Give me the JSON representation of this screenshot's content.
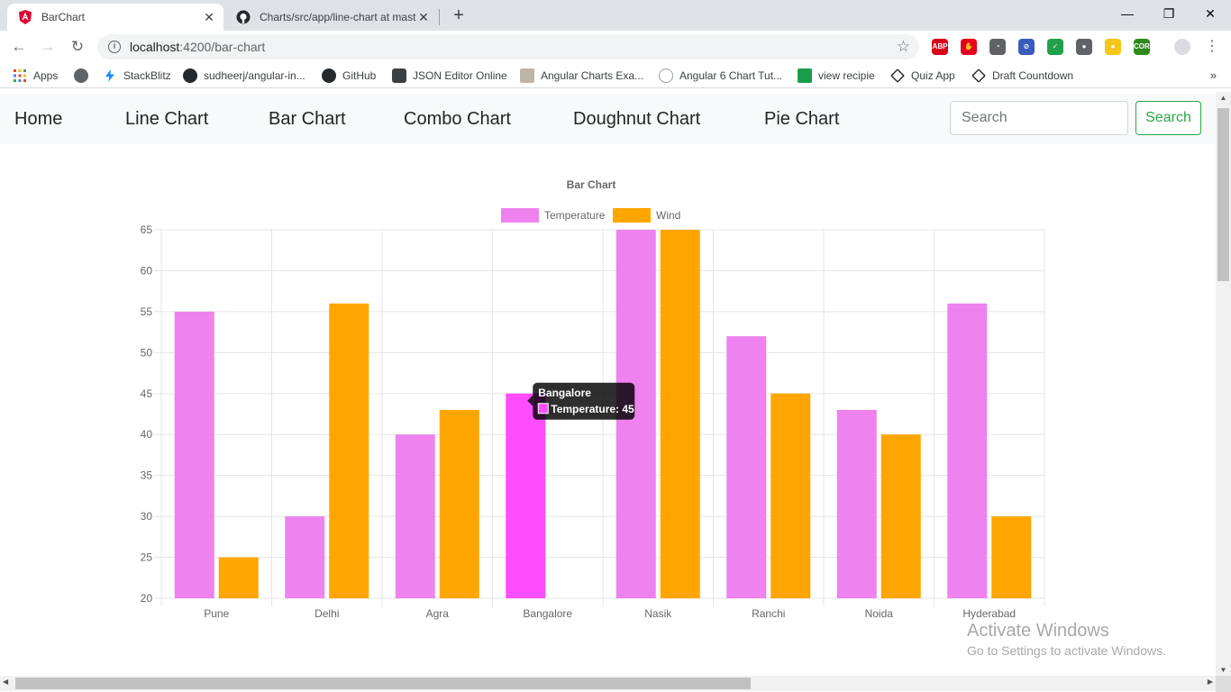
{
  "browser": {
    "tabs": [
      {
        "title": "BarChart",
        "active": true
      },
      {
        "title": "Charts/src/app/line-chart at mast",
        "active": false
      }
    ],
    "new_tab_symbol": "+",
    "close_symbol": "✕",
    "window_controls": {
      "minimize": "—",
      "restore": "❐",
      "close": "✕"
    },
    "url_host": "localhost",
    "url_path": ":4200/bar-chart",
    "extensions": [
      {
        "name": "abp-icon",
        "label": "ABP",
        "color": "#d9001a"
      },
      {
        "name": "stop-icon",
        "label": "✋",
        "color": "#e8001c"
      },
      {
        "name": "gauge-icon",
        "label": "◔",
        "color": "#5f6368"
      },
      {
        "name": "block-icon",
        "label": "⊘",
        "color": "#3a5cbf"
      },
      {
        "name": "shield-icon",
        "label": "✓",
        "color": "#22a04b"
      },
      {
        "name": "bulb-dark-icon",
        "label": "●",
        "color": "#5f6368"
      },
      {
        "name": "bulb-icon",
        "label": "●",
        "color": "#f5c518"
      },
      {
        "name": "cors-icon",
        "label": "CORS",
        "color": "#2f8a1e"
      }
    ],
    "bookmarks": [
      {
        "label": "Apps",
        "icon": "apps-grid-icon"
      },
      {
        "label": "",
        "icon": "globe-icon"
      },
      {
        "label": "StackBlitz",
        "icon": "stackblitz-icon"
      },
      {
        "label": "sudheerj/angular-in...",
        "icon": "github-icon"
      },
      {
        "label": "GitHub",
        "icon": "github-icon"
      },
      {
        "label": "JSON Editor Online",
        "icon": "json-editor-icon"
      },
      {
        "label": "Angular Charts Exa...",
        "icon": "page-icon"
      },
      {
        "label": "Angular 6 Chart Tut...",
        "icon": "link-icon"
      },
      {
        "label": "view recipie",
        "icon": "jsbin-icon"
      },
      {
        "label": "Quiz App",
        "icon": "codepen-icon"
      },
      {
        "label": "Draft Countdown",
        "icon": "codepen-icon"
      }
    ],
    "bookmarks_more": "»"
  },
  "navbar": {
    "links": [
      "Home",
      "Line Chart",
      "Bar Chart",
      "Combo Chart",
      "Doughnut Chart",
      "Pie Chart"
    ],
    "search_placeholder": "Search",
    "search_button": "Search"
  },
  "chart_data": {
    "type": "bar",
    "title": "Bar Chart",
    "categories": [
      "Pune",
      "Delhi",
      "Agra",
      "Bangalore",
      "Nasik",
      "Ranchi",
      "Noida",
      "Hyderabad"
    ],
    "series": [
      {
        "name": "Temperature",
        "color": "#ee82ee",
        "values": [
          55,
          30,
          40,
          45,
          65,
          52,
          43,
          56
        ]
      },
      {
        "name": "Wind",
        "color": "#ffa500",
        "values": [
          25,
          56,
          43,
          20,
          65,
          45,
          40,
          30
        ]
      }
    ],
    "ylim": [
      20,
      65
    ],
    "yticks": [
      20,
      25,
      30,
      35,
      40,
      45,
      50,
      55,
      60,
      65
    ],
    "grid": true,
    "legend": "top",
    "highlight_color": "#ff4dff",
    "tooltip": {
      "title": "Bangalore",
      "label": "Temperature: 45",
      "category_index": 3,
      "series_index": 0
    }
  },
  "watermark": {
    "line1": "Activate Windows",
    "line2": "Go to Settings to activate Windows."
  }
}
